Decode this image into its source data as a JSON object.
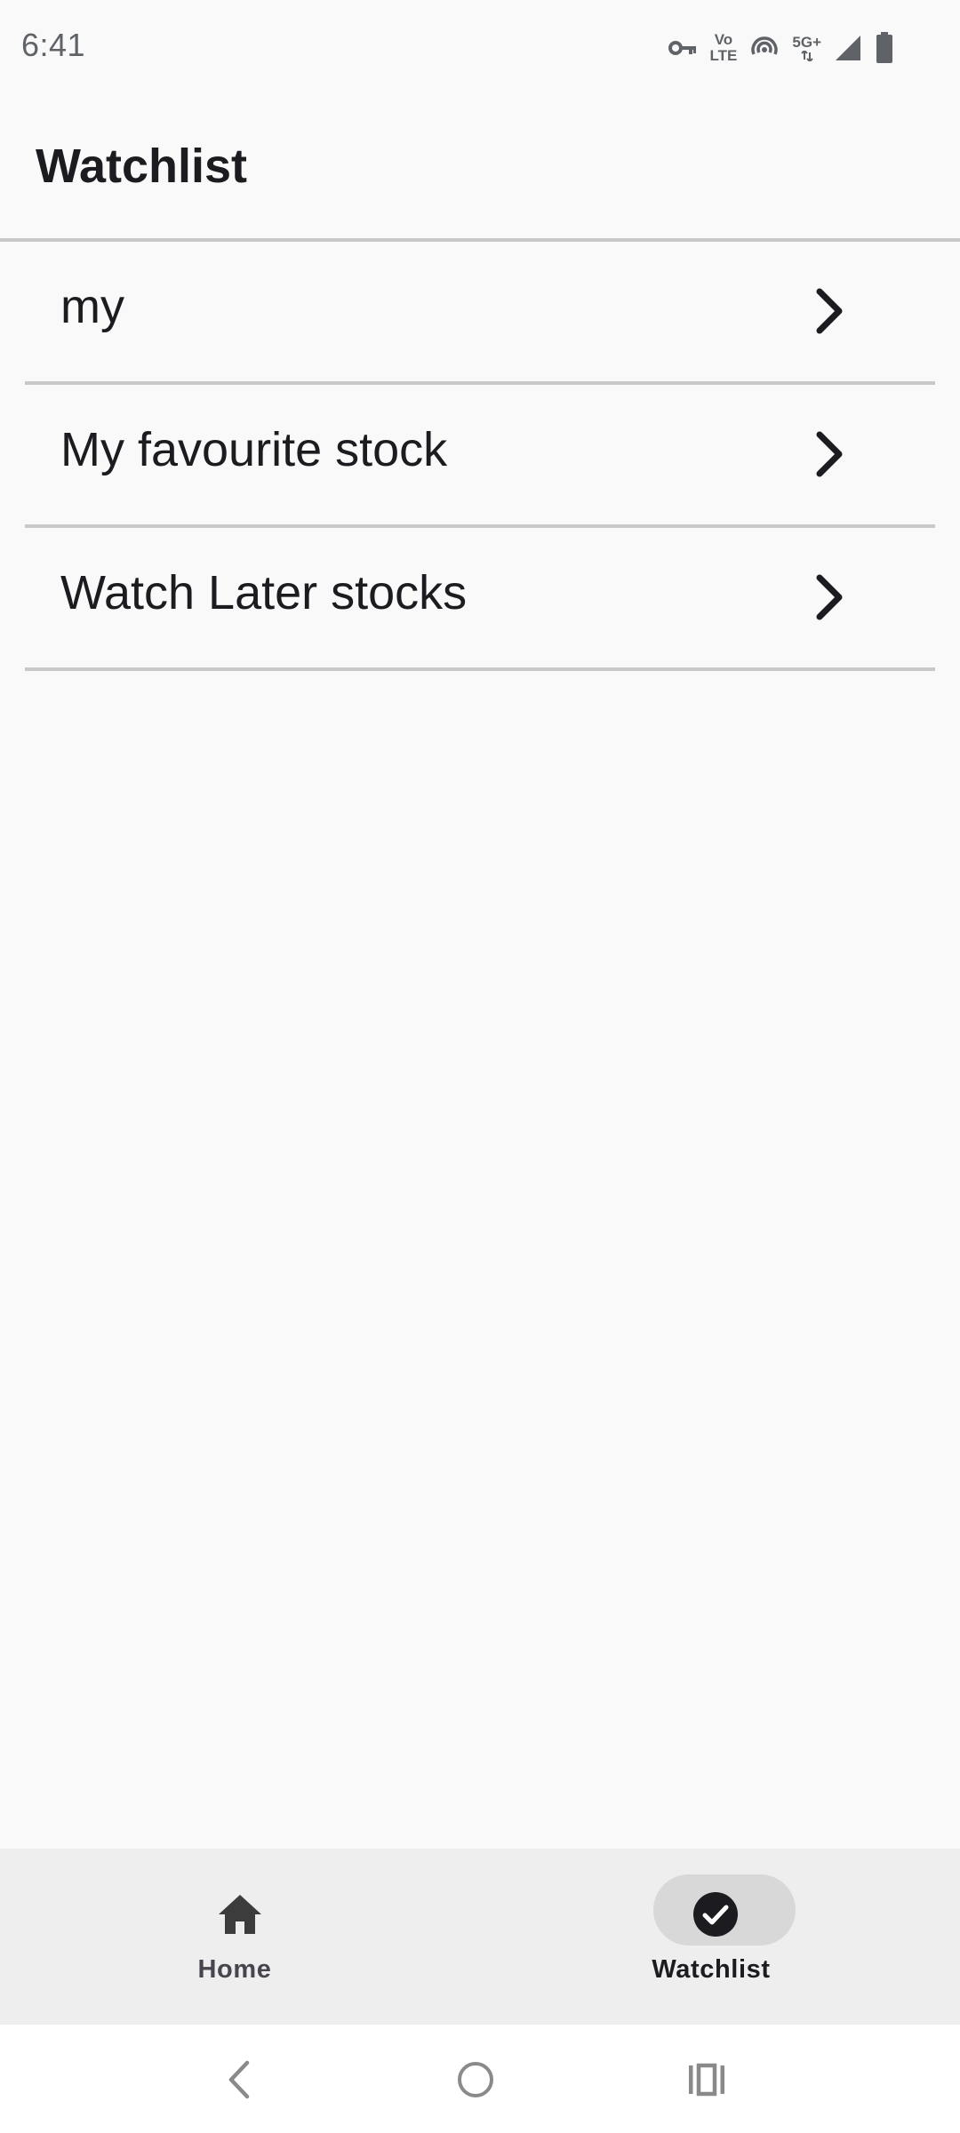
{
  "status_bar": {
    "time": "6:41",
    "volte_top": "Vo",
    "volte_bottom": "LTE",
    "network": "5G+",
    "icons": [
      "vpn-key-icon",
      "volte-icon",
      "hotspot-icon",
      "network-5g-icon",
      "signal-icon",
      "battery-icon"
    ]
  },
  "header": {
    "title": "Watchlist"
  },
  "watchlists": [
    {
      "label": "my"
    },
    {
      "label": "My favourite stock"
    },
    {
      "label": "Watch Later stocks"
    }
  ],
  "bottom_nav": {
    "items": [
      {
        "label": "Home",
        "icon": "home-icon",
        "selected": false
      },
      {
        "label": "Watchlist",
        "icon": "check-circle-icon",
        "selected": true
      }
    ]
  },
  "system_nav": {
    "buttons": [
      "back-icon",
      "home-circle-icon",
      "recents-icon"
    ]
  },
  "colors": {
    "background": "#f9f9f9",
    "divider": "#c8c8c8",
    "nav_background": "#eeeeee",
    "nav_indicator": "#d8d8d8",
    "text_primary": "#1c1b1f"
  }
}
